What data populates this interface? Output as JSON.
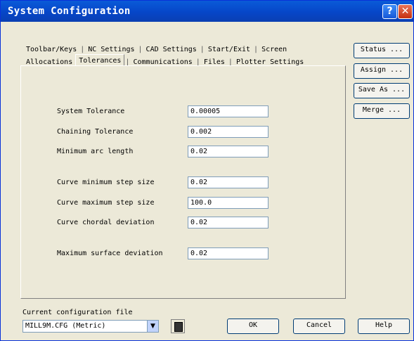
{
  "window": {
    "title": "System Configuration"
  },
  "title_buttons": {
    "help": "?",
    "close": "✕"
  },
  "tabs_row1": [
    "Toolbar/Keys",
    "NC Settings",
    "CAD Settings",
    "Start/Exit",
    "Screen"
  ],
  "tabs_row2": [
    "Allocations",
    "Tolerances",
    "Communications",
    "Files",
    "Plotter Settings"
  ],
  "active_tab": "Tolerances",
  "fields": {
    "system_tolerance": {
      "label": "System Tolerance",
      "value": "0.00005"
    },
    "chaining_tolerance": {
      "label": "Chaining Tolerance",
      "value": "0.002"
    },
    "min_arc_length": {
      "label": "Minimum arc length",
      "value": "0.02"
    },
    "curve_min_step": {
      "label": "Curve minimum step size",
      "value": "0.02"
    },
    "curve_max_step": {
      "label": "Curve maximum step size",
      "value": "100.0"
    },
    "curve_chordal": {
      "label": "Curve chordal deviation",
      "value": "0.02"
    },
    "max_surface_dev": {
      "label": "Maximum surface deviation",
      "value": "0.02"
    }
  },
  "side_buttons": {
    "status": "Status ...",
    "assign": "Assign ...",
    "save_as": "Save As ...",
    "merge": "Merge ..."
  },
  "config_file": {
    "label": "Current configuration file",
    "value": "MILL9M.CFG (Metric)"
  },
  "bottom_buttons": {
    "ok": "OK",
    "cancel": "Cancel",
    "help": "Help"
  }
}
